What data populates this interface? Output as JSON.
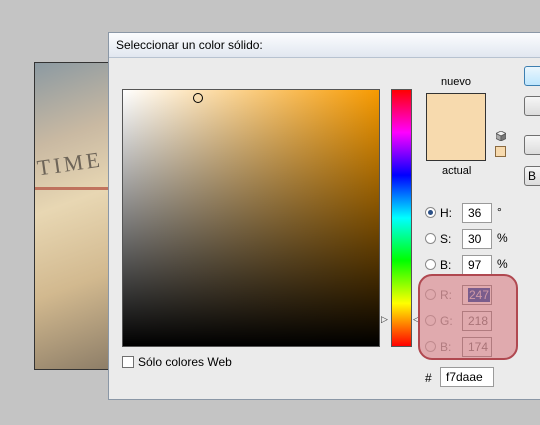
{
  "dialog": {
    "title": "Seleccionar un color sólido:"
  },
  "swatch": {
    "new_label": "nuevo",
    "current_label": "actual",
    "new_color": "#f7daae",
    "current_color": "#f7daae"
  },
  "fields": {
    "h": {
      "label": "H:",
      "value": "36",
      "unit": "°",
      "selected": true
    },
    "s": {
      "label": "S:",
      "value": "30",
      "unit": "%"
    },
    "b_hsb": {
      "label": "B:",
      "value": "97",
      "unit": "%"
    },
    "r": {
      "label": "R:",
      "value": "247"
    },
    "g": {
      "label": "G:",
      "value": "218"
    },
    "b_rgb": {
      "label": "B:",
      "value": "174"
    }
  },
  "hex": {
    "label": "#",
    "value": "f7daae"
  },
  "web_colors": {
    "label": "Sólo colores Web",
    "checked": false
  },
  "buttons": {
    "partial_label": "B"
  },
  "colors": {
    "hue_accent": "#f79a00",
    "highlight": "#d2505a"
  },
  "background": {
    "photo_text": "TIME"
  }
}
